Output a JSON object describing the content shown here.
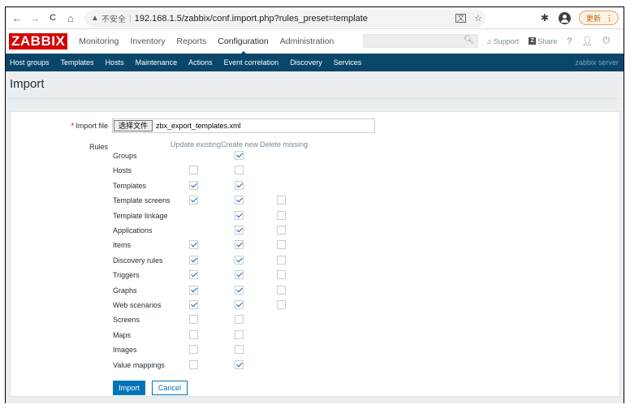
{
  "browser": {
    "back_icon": "←",
    "forward_icon": "→",
    "reload_icon": "C",
    "home_icon": "⌂",
    "warning_icon": "▲",
    "insecure_label": "不安全",
    "separator": "|",
    "url": "192.168.1.5/zabbix/conf.import.php?rules_preset=template",
    "update_label": "更新",
    "update_menu": "⋮"
  },
  "header": {
    "logo": "ZABBIX",
    "menu": [
      "Monitoring",
      "Inventory",
      "Reports",
      "Configuration",
      "Administration"
    ],
    "active_menu": "Configuration",
    "search_value": "",
    "support_label": "Support",
    "share_label": "Share",
    "share_box": "Z",
    "help_label": "?"
  },
  "submenu": {
    "items": [
      "Host groups",
      "Templates",
      "Hosts",
      "Maintenance",
      "Actions",
      "Event correlation",
      "Discovery",
      "Services"
    ],
    "server_name": "zabbix server"
  },
  "page": {
    "title": "Import",
    "import_file_label": "Import file",
    "required_mark": "*",
    "file_button": "选择文件",
    "file_name": "zbx_export_templates.xml",
    "rules_label": "Rules",
    "columns": [
      "Update existing",
      "Create new",
      "Delete missing"
    ],
    "rules": [
      {
        "name": "Groups",
        "update": null,
        "create": true,
        "delete": null
      },
      {
        "name": "Hosts",
        "update": false,
        "create": false,
        "delete": null
      },
      {
        "name": "Templates",
        "update": true,
        "create": true,
        "delete": null
      },
      {
        "name": "Template screens",
        "update": true,
        "create": true,
        "delete": false
      },
      {
        "name": "Template linkage",
        "update": null,
        "create": true,
        "delete": false
      },
      {
        "name": "Applications",
        "update": null,
        "create": true,
        "delete": false
      },
      {
        "name": "Items",
        "update": true,
        "create": true,
        "delete": false
      },
      {
        "name": "Discovery rules",
        "update": true,
        "create": true,
        "delete": false
      },
      {
        "name": "Triggers",
        "update": true,
        "create": true,
        "delete": false
      },
      {
        "name": "Graphs",
        "update": true,
        "create": true,
        "delete": false
      },
      {
        "name": "Web scenarios",
        "update": true,
        "create": true,
        "delete": false
      },
      {
        "name": "Screens",
        "update": false,
        "create": false,
        "delete": null
      },
      {
        "name": "Maps",
        "update": false,
        "create": false,
        "delete": null
      },
      {
        "name": "Images",
        "update": false,
        "create": false,
        "delete": null
      },
      {
        "name": "Value mappings",
        "update": false,
        "create": true,
        "delete": null
      }
    ],
    "import_button": "Import",
    "cancel_button": "Cancel"
  },
  "colors": {
    "brand": "#d40000",
    "nav": "#0a466a",
    "primary": "#0275b8"
  }
}
